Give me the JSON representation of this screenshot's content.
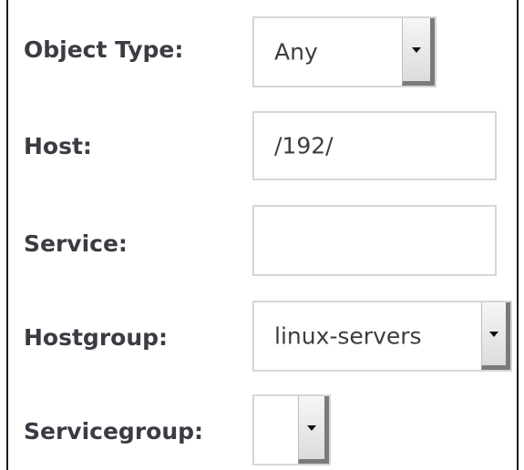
{
  "filters": {
    "object_type": {
      "label": "Object Type:",
      "value": "Any"
    },
    "host": {
      "label": "Host:",
      "value": "/192/"
    },
    "service": {
      "label": "Service:",
      "value": ""
    },
    "hostgroup": {
      "label": "Hostgroup:",
      "value": "linux-servers"
    },
    "servicegroup": {
      "label": "Servicegroup:",
      "value": ""
    }
  },
  "icons": {
    "dropdown": "chevron-down-icon"
  },
  "colors": {
    "label_text": "#3a3c43",
    "field_border": "#d6d6d6",
    "panel_border": "#1a1a1a"
  }
}
